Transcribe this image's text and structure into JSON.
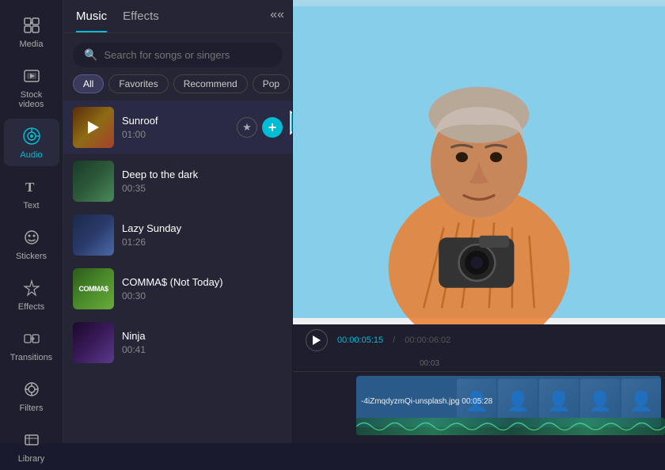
{
  "sidebar": {
    "items": [
      {
        "id": "media",
        "label": "Media",
        "icon": "▣"
      },
      {
        "id": "stock",
        "label": "Stock videos",
        "icon": "⊞"
      },
      {
        "id": "audio",
        "label": "Audio",
        "icon": "♪",
        "active": true
      },
      {
        "id": "text",
        "label": "Text",
        "icon": "T"
      },
      {
        "id": "stickers",
        "label": "Stickers",
        "icon": "◎"
      },
      {
        "id": "effects",
        "label": "Effects",
        "icon": "✦"
      },
      {
        "id": "transitions",
        "label": "Transitions",
        "icon": "⇌"
      },
      {
        "id": "filters",
        "label": "Filters",
        "icon": "⊙"
      },
      {
        "id": "library",
        "label": "Library",
        "icon": "⊟"
      }
    ]
  },
  "panel": {
    "tabs": [
      {
        "id": "music",
        "label": "Music",
        "active": true
      },
      {
        "id": "effects",
        "label": "Effects",
        "active": false
      }
    ],
    "search_placeholder": "Search for songs or singers",
    "filters": [
      {
        "id": "all",
        "label": "All",
        "active": true
      },
      {
        "id": "favorites",
        "label": "Favorites",
        "active": false
      },
      {
        "id": "recommend",
        "label": "Recommend",
        "active": false
      },
      {
        "id": "pop",
        "label": "Pop",
        "active": false
      }
    ],
    "songs": [
      {
        "id": "sunroof",
        "title": "Sunroof",
        "duration": "01:00",
        "thumb_class": "thumb-sunroof",
        "playing": true
      },
      {
        "id": "deep",
        "title": "Deep to the dark",
        "duration": "00:35",
        "thumb_class": "thumb-deep",
        "playing": false
      },
      {
        "id": "lazy",
        "title": "Lazy Sunday",
        "duration": "01:26",
        "thumb_class": "thumb-lazy",
        "playing": false
      },
      {
        "id": "comma",
        "title": "COMMA$ (Not Today)",
        "duration": "00:30",
        "thumb_class": "thumb-comma",
        "playing": false
      },
      {
        "id": "ninja",
        "title": "Ninja",
        "duration": "00:41",
        "thumb_class": "thumb-ninja",
        "playing": false
      }
    ]
  },
  "video": {
    "current_time": "00:00:05:15",
    "total_time": "00:00:06:02"
  },
  "timeline": {
    "ruler_mark": "00:03",
    "filename": "-4iZmqdyzmQi-unsplash.jpg",
    "file_duration": "00:05:28"
  }
}
